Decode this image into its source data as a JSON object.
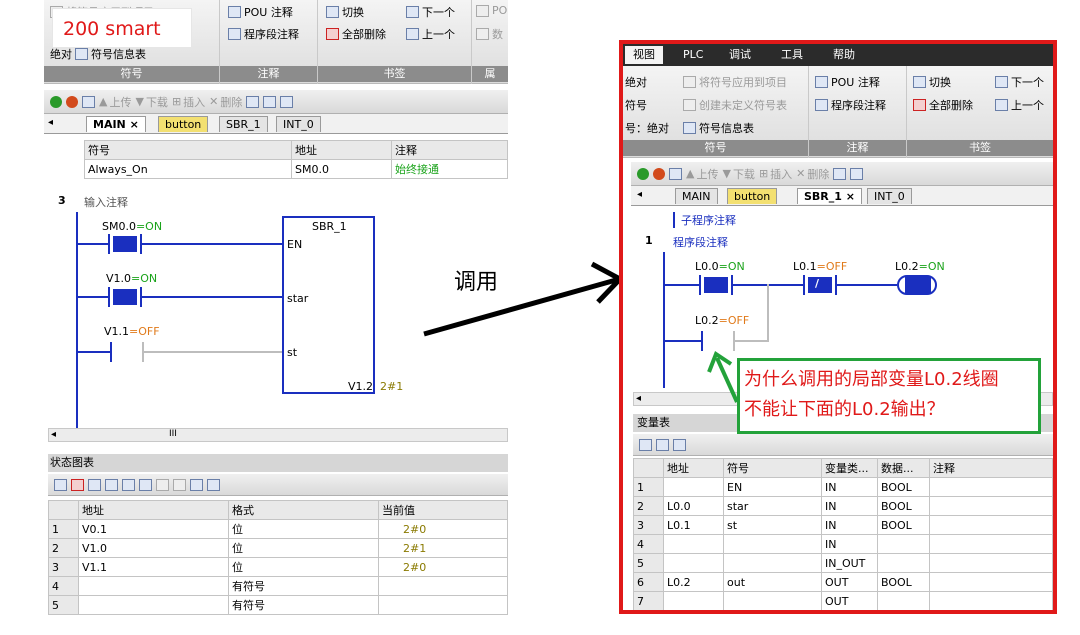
{
  "label_200smart": "200 smart",
  "call_label": "调用",
  "left": {
    "ribbon": {
      "groups": [
        "符号",
        "注释",
        "书签",
        "属"
      ],
      "items": {
        "project_fragment": "将符号应用到项目",
        "symbol_fragment": "号表",
        "symbol_info": "符号信息表",
        "abs_fragment": "绝对",
        "pou_comment": "POU 注释",
        "network_comment": "程序段注释",
        "toggle": "切换",
        "delete_all": "全部删除",
        "next": "下一个",
        "prev": "上一个",
        "po_fragment": "PO",
        "data_fragment": "数"
      }
    },
    "toolbar": {
      "upload": "上传",
      "download": "下载",
      "insert": "插入",
      "delete": "删除"
    },
    "tabs": [
      {
        "label": "MAIN",
        "close": "×"
      },
      {
        "label": "button"
      },
      {
        "label": "SBR_1"
      },
      {
        "label": "INT_0"
      }
    ],
    "symbol_table": {
      "headers": [
        "符号",
        "地址",
        "注释"
      ],
      "row": {
        "symbol": "Always_On",
        "address": "SM0.0",
        "comment": "始终接通"
      }
    },
    "network": {
      "number": "3",
      "comment": "输入注释",
      "contacts": [
        {
          "name": "SM0.0",
          "state": "=ON"
        },
        {
          "name": "V1.0",
          "state": "=ON"
        },
        {
          "name": "V1.1",
          "state": "=OFF"
        }
      ],
      "box": {
        "title": "SBR_1",
        "pins": [
          "EN",
          "star",
          "st"
        ],
        "out_pin": "V1.2",
        "out_value": "2#1"
      }
    },
    "status": {
      "title": "状态图表",
      "headers": [
        "地址",
        "格式",
        "当前值"
      ],
      "rows": [
        {
          "n": "1",
          "addr": "V0.1",
          "fmt": "位",
          "val": "2#0"
        },
        {
          "n": "2",
          "addr": "V1.0",
          "fmt": "位",
          "val": "2#1"
        },
        {
          "n": "3",
          "addr": "V1.1",
          "fmt": "位",
          "val": "2#0"
        },
        {
          "n": "4",
          "addr": "",
          "fmt": "有符号",
          "val": ""
        },
        {
          "n": "5",
          "addr": "",
          "fmt": "有符号",
          "val": ""
        }
      ],
      "scroll_mark": "III"
    }
  },
  "right": {
    "menu": [
      "视图",
      "PLC",
      "调试",
      "工具",
      "帮助"
    ],
    "ribbon": {
      "groups": [
        "符号",
        "注释",
        "书签"
      ],
      "items": {
        "abs_fragment": "绝对",
        "symbol_fragment": "符号",
        "abs2_fragment": "号：绝对",
        "apply_symbols": "将符号应用到项目",
        "create_undefined": "创建未定义符号表",
        "symbol_info": "符号信息表",
        "pou_comment": "POU 注释",
        "network_comment": "程序段注释",
        "toggle": "切换",
        "delete_all": "全部删除",
        "next": "下一个",
        "prev": "上一个"
      }
    },
    "toolbar": {
      "upload": "上传",
      "download": "下载",
      "insert": "插入",
      "delete": "删除"
    },
    "tabs": [
      {
        "label": "MAIN"
      },
      {
        "label": "button"
      },
      {
        "label": "SBR_1",
        "close": "×"
      },
      {
        "label": "INT_0"
      }
    ],
    "subroutine_comment": "子程序注释",
    "network": {
      "number": "1",
      "comment": "程序段注释",
      "contacts": [
        {
          "name": "L0.0",
          "state": "=ON"
        },
        {
          "name": "L0.1",
          "state": "=OFF"
        },
        {
          "name": "L0.2",
          "state": "=OFF"
        }
      ],
      "coil": {
        "name": "L0.2",
        "state": "=ON"
      }
    },
    "var_table": {
      "title": "变量表",
      "headers": [
        "",
        "地址",
        "符号",
        "变量类...",
        "数据...",
        "注释"
      ],
      "rows": [
        {
          "n": "1",
          "addr": "",
          "sym": "EN",
          "type": "IN",
          "data": "BOOL"
        },
        {
          "n": "2",
          "addr": "L0.0",
          "sym": "star",
          "type": "IN",
          "data": "BOOL"
        },
        {
          "n": "3",
          "addr": "L0.1",
          "sym": "st",
          "type": "IN",
          "data": "BOOL"
        },
        {
          "n": "4",
          "addr": "",
          "sym": "",
          "type": "IN",
          "data": ""
        },
        {
          "n": "5",
          "addr": "",
          "sym": "",
          "type": "IN_OUT",
          "data": ""
        },
        {
          "n": "6",
          "addr": "L0.2",
          "sym": "out",
          "type": "OUT",
          "data": "BOOL"
        },
        {
          "n": "7",
          "addr": "",
          "sym": "",
          "type": "OUT",
          "data": ""
        }
      ]
    },
    "question": {
      "line1": "为什么调用的局部变量L0.2线圈",
      "line2": "不能让下面的L0.2输出？"
    }
  }
}
